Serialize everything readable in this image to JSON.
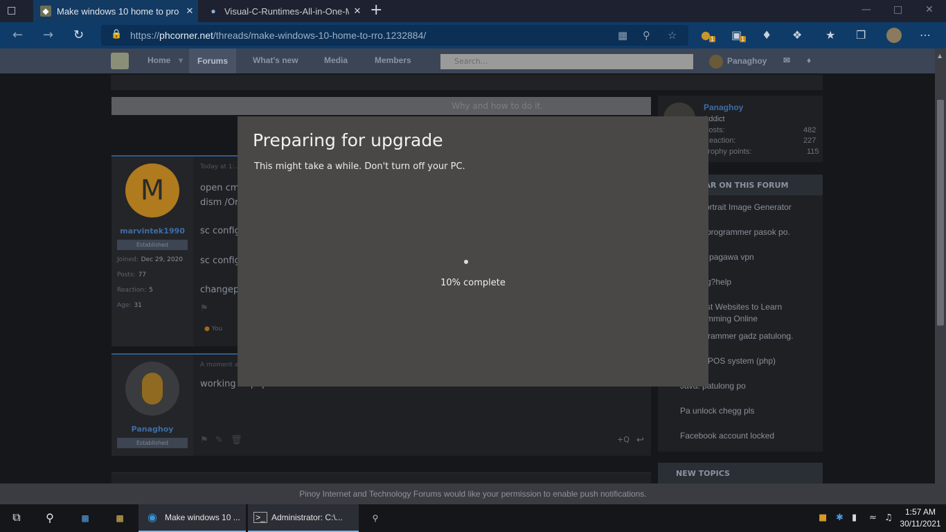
{
  "browser": {
    "tabs": [
      {
        "title": "Make windows 10 home to pro",
        "favicon": "phcorner-icon",
        "active": true
      },
      {
        "title": "Visual-C-Runtimes-All-in-One-M",
        "favicon": "techpowerup-icon",
        "active": false
      }
    ],
    "address": {
      "prefix": "https://",
      "host": "phcorner.net",
      "path": "/threads/make-windows-10-home-to-rro.1232884/"
    },
    "toolbar_badges": [
      "1",
      "1"
    ]
  },
  "site": {
    "nav": {
      "home": "Home",
      "forums": "Forums",
      "whats_new": "What's new",
      "media": "Media",
      "members": "Members"
    },
    "search_placeholder": "Search...",
    "username": "Panaghoy",
    "notice_text": "Why and how to do it.",
    "post1": {
      "avatar_letter": "M",
      "username": "marvintek1990",
      "badge": "Established",
      "joined_label": "Joined:",
      "joined": "Dec 29, 2020",
      "posts_label": "Posts:",
      "posts": "77",
      "reaction_label": "Reaction:",
      "reaction": "5",
      "age_label": "Age:",
      "age": "31",
      "date": "Today at 1:...",
      "lines": [
        "open cm",
        "dism /On",
        "sc config",
        "sc config",
        "changep"
      ],
      "reaction_user": "You"
    },
    "post2": {
      "username": "Panaghoy",
      "badge": "Established",
      "date": "A moment ago",
      "text": "working to paps thanks bossss we ca nano sukkoklosa"
    },
    "profile_card": {
      "name": "Panaghoy",
      "title": "Addict",
      "posts_label": "Posts:",
      "posts": "482",
      "reaction_label": "Reaction:",
      "reaction": "227",
      "trophy_label": "Trophy points:",
      "trophy": "115"
    },
    "popular_heading": "POPULAR ON THIS FORUM",
    "popular": [
      "Portrait Image Generator",
      "programmer pasok po.",
      "pagawa vpn",
      "g?help",
      "st Websites to Learn",
      "mming Online",
      "rammer gadz patulong.",
      "POS system (php)",
      "Java: patulong po",
      "Pa unlock chegg pls",
      "Facebook account locked"
    ],
    "new_topics_heading": "NEW TOPICS",
    "push_notice": "Pinoy Internet and Technology Forums would like your permission to enable push notifications."
  },
  "modal": {
    "title": "Preparing for upgrade",
    "subtitle": "This might take a while. Don't turn off your PC.",
    "progress_text": "10% complete",
    "progress_percent": 10
  },
  "taskbar": {
    "edge_task": "Make windows 10 ...",
    "cmd_task": "Administrator: C:\\...",
    "time": "1:57 AM",
    "date": "30/11/2021"
  }
}
